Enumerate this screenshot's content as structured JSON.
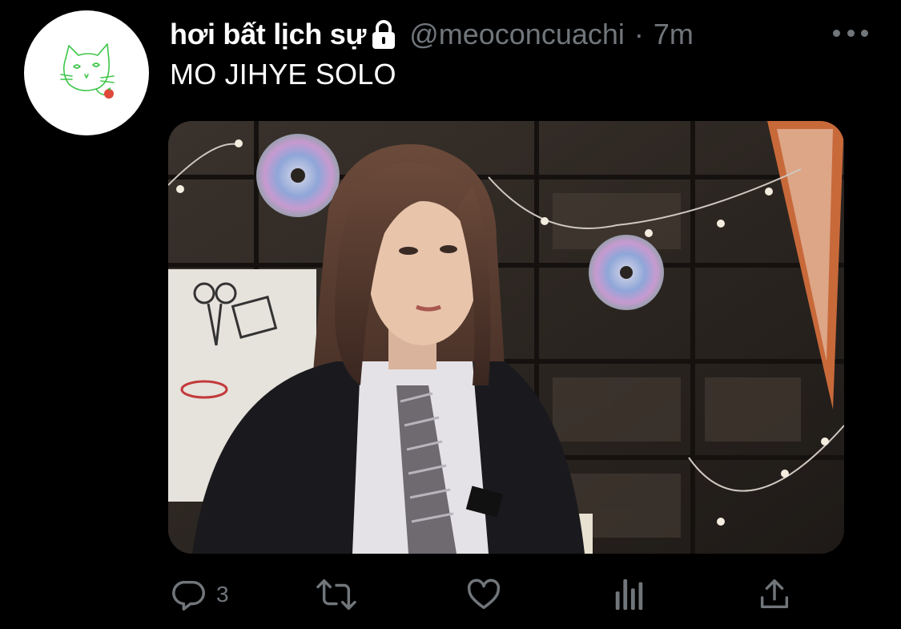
{
  "tweet": {
    "display_name": "hơi bất lịch sự",
    "handle": "@meoconcuachi",
    "separator": "·",
    "time": "7m",
    "text": "MO JIHYE SOLO",
    "protected_icon": "lock-icon",
    "avatar_icon": "cat-doodle",
    "media_label": "photo of a girl in a school uniform in front of wooden drawers with hanging CDs and string lights"
  },
  "actions": {
    "reply_count": "3",
    "retweet_count": "",
    "like_count": "",
    "icons": [
      "reply-icon",
      "retweet-icon",
      "like-icon",
      "analytics-icon",
      "share-icon"
    ]
  },
  "colors": {
    "background": "#000000",
    "primary_text": "#ffffff",
    "secondary_text": "#71767b"
  }
}
